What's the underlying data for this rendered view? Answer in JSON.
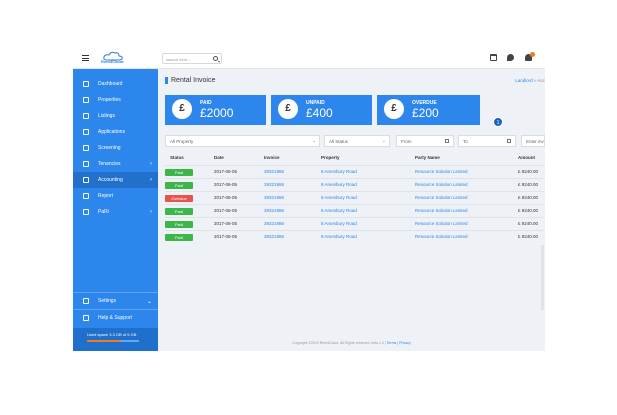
{
  "topbar": {
    "logo_text": "Rent4Cloud",
    "search_placeholder": "search here..."
  },
  "sidebar": {
    "items": [
      {
        "label": "Dashboard",
        "icon": "home-icon",
        "chevron": ""
      },
      {
        "label": "Properties",
        "icon": "building-icon",
        "chevron": ""
      },
      {
        "label": "Listings",
        "icon": "list-icon",
        "chevron": ""
      },
      {
        "label": "Applications",
        "icon": "file-icon",
        "chevron": ""
      },
      {
        "label": "Screening",
        "icon": "screening-icon",
        "chevron": ""
      },
      {
        "label": "Tenancies",
        "icon": "tenancy-icon",
        "chevron": "›"
      },
      {
        "label": "Accounting",
        "icon": "calendar-icon",
        "chevron": "›"
      },
      {
        "label": "Report",
        "icon": "chart-icon",
        "chevron": ""
      },
      {
        "label": "PaRi",
        "icon": "wrench-icon",
        "chevron": "›"
      }
    ],
    "bottom_items": [
      {
        "label": "Settings",
        "icon": "gear-icon",
        "chevron": "⌄"
      },
      {
        "label": "Help & Support",
        "icon": "headset-icon",
        "chevron": ""
      }
    ],
    "usage_text": "Used space 3.3 GB of 5 GB",
    "usage_fraction": 0.66
  },
  "page": {
    "title": "Rental Invoice",
    "breadcrumb_link": "Landlord",
    "breadcrumb_sep": " » ",
    "breadcrumb_current": "Acc"
  },
  "cards": [
    {
      "symbol": "£",
      "label": "PAID",
      "value": "£2000"
    },
    {
      "symbol": "£",
      "label": "UNPAID",
      "value": "£400"
    },
    {
      "symbol": "£",
      "label": "OVERDUE",
      "value": "£200"
    }
  ],
  "page_badge": "1",
  "filters": {
    "property": "All Property",
    "status": "All Status",
    "from": "From",
    "to": "To",
    "enter": "Enter inv"
  },
  "table": {
    "headers": [
      "Status",
      "Date",
      "Invoice",
      "Property",
      "Party Name",
      "Amount"
    ],
    "rows": [
      {
        "status": "Paid",
        "status_color": "#3cb54a",
        "date": "2017-06-05",
        "invoice": "39321986",
        "property": "8 Amesbury Road",
        "party": "Resource Solution Limited",
        "amount": "£ 9240.00"
      },
      {
        "status": "Paid",
        "status_color": "#3cb54a",
        "date": "2017-06-05",
        "invoice": "39321986",
        "property": "8 Amesbury Road",
        "party": "Resource Solution Limited",
        "amount": "£ 9240.00"
      },
      {
        "status": "Overdue",
        "status_color": "#e8524f",
        "date": "2017-06-05",
        "invoice": "39321986",
        "property": "8 Amesbury Road",
        "party": "Resource Solution Limited",
        "amount": "£ 9240.00"
      },
      {
        "status": "Paid",
        "status_color": "#3cb54a",
        "date": "2017-06-05",
        "invoice": "39321986",
        "property": "8 Amesbury Road",
        "party": "Resource Solution Limited",
        "amount": "£ 9240.00"
      },
      {
        "status": "Paid",
        "status_color": "#3cb54a",
        "date": "2017-06-05",
        "invoice": "39321986",
        "property": "8 Amesbury Road",
        "party": "Resource Solution Limited",
        "amount": "£ 9240.00"
      },
      {
        "status": "Paid",
        "status_color": "#3cb54a",
        "date": "2017-06-05",
        "invoice": "39321986",
        "property": "8 Amesbury Road",
        "party": "Resource Solution Limited",
        "amount": "£ 9240.00"
      }
    ]
  },
  "footer": {
    "text": "Copyright ©2019 Rent4Cloud. All Rights reserved. beta 1.0 | ",
    "link": "Terms | Privacy"
  },
  "colors": {
    "primary": "#2d86ec",
    "sidebar_active": "#2170cc",
    "paid": "#3cb54a",
    "overdue": "#e8524f",
    "accent": "#f07b1a"
  }
}
